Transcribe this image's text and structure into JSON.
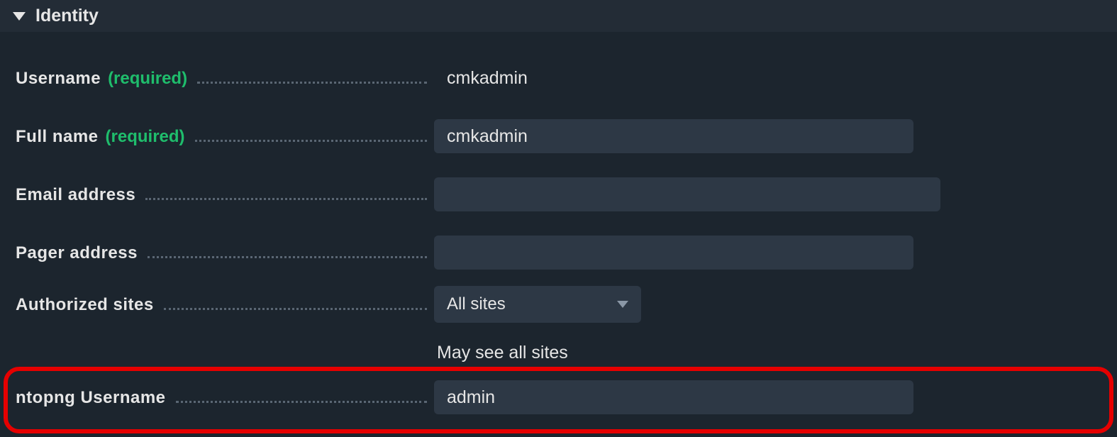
{
  "section": {
    "title": "Identity"
  },
  "fields": {
    "username": {
      "label": "Username",
      "required_text": "(required)",
      "value": "cmkadmin"
    },
    "fullname": {
      "label": "Full name",
      "required_text": "(required)",
      "value": "cmkadmin"
    },
    "email": {
      "label": "Email address",
      "value": ""
    },
    "pager": {
      "label": "Pager address",
      "value": ""
    },
    "auth_sites": {
      "label": "Authorized sites",
      "selected": "All sites",
      "helper": "May see all sites"
    },
    "ntopng": {
      "label": "ntopng Username",
      "value": "admin"
    }
  }
}
